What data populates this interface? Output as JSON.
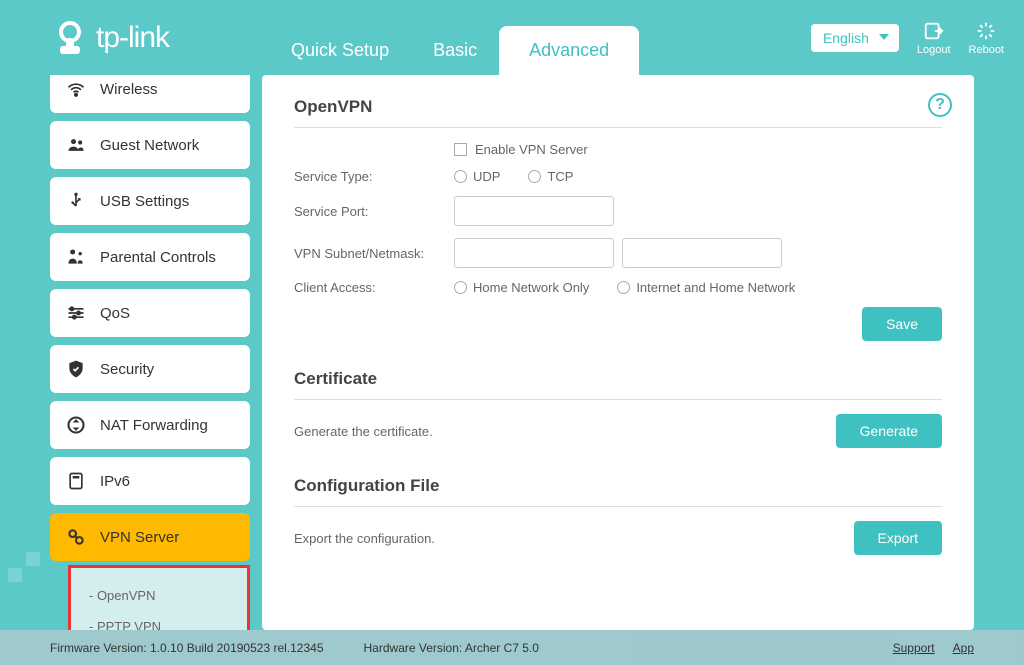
{
  "brand": "tp-link",
  "tabs": {
    "quick_setup": "Quick Setup",
    "basic": "Basic",
    "advanced": "Advanced"
  },
  "header": {
    "language": "English",
    "logout": "Logout",
    "reboot": "Reboot"
  },
  "sidebar": {
    "wireless": "Wireless",
    "guest_network": "Guest Network",
    "usb_settings": "USB Settings",
    "parental_controls": "Parental Controls",
    "qos": "QoS",
    "security": "Security",
    "nat_forwarding": "NAT Forwarding",
    "ipv6": "IPv6",
    "vpn_server": "VPN Server",
    "sub_openvpn": "- OpenVPN",
    "sub_pptp": "- PPTP VPN"
  },
  "openvpn": {
    "title": "OpenVPN",
    "enable_label": "Enable VPN Server",
    "service_type_label": "Service Type:",
    "udp": "UDP",
    "tcp": "TCP",
    "service_port_label": "Service Port:",
    "subnet_label": "VPN Subnet/Netmask:",
    "client_access_label": "Client Access:",
    "home_only": "Home Network Only",
    "internet_home": "Internet and Home Network",
    "save": "Save"
  },
  "certificate": {
    "title": "Certificate",
    "desc": "Generate the certificate.",
    "btn": "Generate"
  },
  "config_file": {
    "title": "Configuration File",
    "desc": "Export the configuration.",
    "btn": "Export"
  },
  "footer": {
    "firmware": "Firmware Version: 1.0.10 Build 20190523 rel.12345",
    "hardware": "Hardware Version: Archer C7 5.0",
    "support": "Support",
    "app": "App"
  }
}
